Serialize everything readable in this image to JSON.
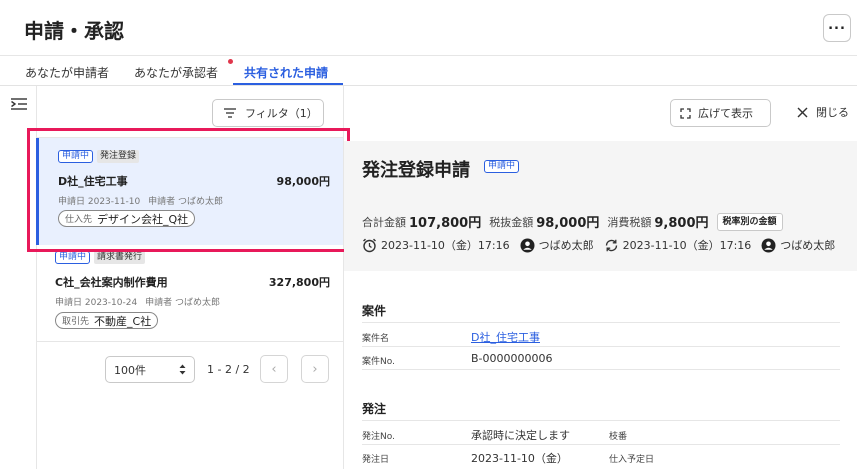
{
  "header": {
    "title": "申請・承認",
    "more_label": "..."
  },
  "tabs": [
    {
      "label": "あなたが申請者"
    },
    {
      "label": "あなたが承認者"
    },
    {
      "label": "共有された申請"
    }
  ],
  "list": {
    "filter_label": "フィルタ（1）",
    "items": [
      {
        "status": "申請中",
        "type": "発注登録",
        "title": "D社_住宅工事",
        "amount": "98,000円",
        "date": "申請日 2023-11-10",
        "applicant": "申請者 つばめ太郎",
        "partner_label": "仕入先",
        "partner_name": "デザイン会社_Q社"
      },
      {
        "status": "申請中",
        "type": "請求書発行",
        "title": "C社_会社案内制作費用",
        "amount": "327,800円",
        "date": "申請日 2023-10-24",
        "applicant": "申請者 つばめ太郎",
        "partner_label": "取引先",
        "partner_name": "不動産_C社"
      }
    ],
    "pagination": {
      "page_size": "100件",
      "range": "1 - 2 / 2",
      "prev": "‹",
      "next": "›"
    }
  },
  "detail": {
    "expand_label": "広げて表示",
    "close_label": "閉じる",
    "title": "発注登録申請",
    "status": "申請中",
    "total_label": "合計金額",
    "total_value": "107,800円",
    "pretax_label": "税抜金額",
    "pretax_value": "98,000円",
    "tax_label": "消費税額",
    "tax_value": "9,800円",
    "tax_breakdown_label": "税率別の金額",
    "created_at": "2023-11-10（金）17:16",
    "created_by": "つばめ太郎",
    "updated_at": "2023-11-10（金）17:16",
    "updated_by": "つばめ太郎",
    "project": {
      "section_title": "案件",
      "name_label": "案件名",
      "name_value": "D社_住宅工事",
      "no_label": "案件No.",
      "no_value": "B-0000000006"
    },
    "order": {
      "section_title": "発注",
      "no_label": "発注No.",
      "no_value": "承認時に決定します",
      "branch_label": "枝番",
      "date_label": "発注日",
      "date_value": "2023-11-10（金）",
      "scheduled_label": "仕入予定日"
    }
  },
  "colors": {
    "accent": "#2b5fe0",
    "highlight": "#e8195a",
    "notification": "#e0364b"
  }
}
